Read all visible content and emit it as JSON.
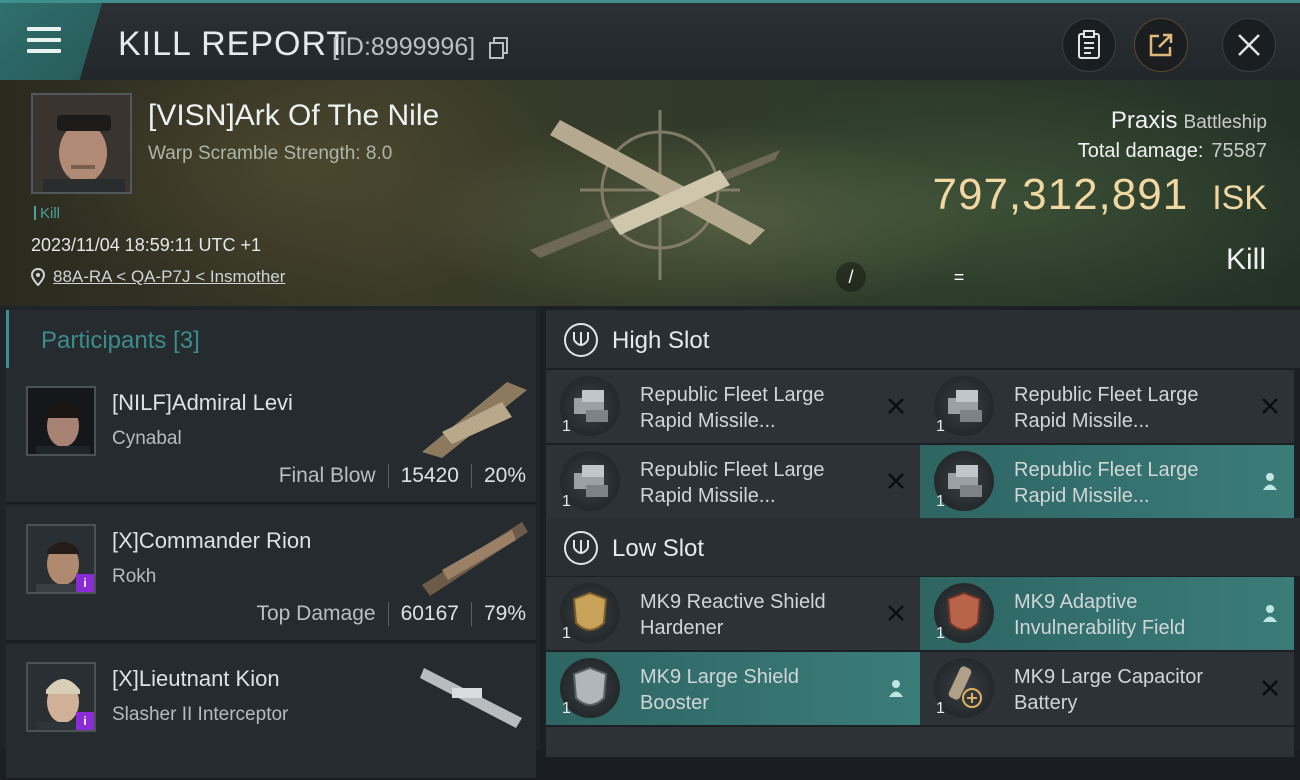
{
  "header": {
    "title": "KILL REPORT",
    "report_id": "[ID:8999996]"
  },
  "victim": {
    "name": "[VISN]Ark Of The Nile",
    "warp_scramble": "Warp Scramble Strength: 8.0",
    "tag": "Kill",
    "timestamp": "2023/11/04 18:59:11 UTC +1",
    "location": "88A-RA < QA-P7J < Insmother",
    "ship": "Praxis",
    "ship_class": "Battleship",
    "total_damage_label": "Total damage:",
    "total_damage": "75587",
    "isk_value": "797,312,891",
    "isk_unit": "ISK",
    "result": "Kill",
    "mark_a": "/",
    "mark_b": "="
  },
  "participants": {
    "title": "Participants [3]",
    "items": [
      {
        "name": "[NILF]Admiral Levi",
        "ship": "Cynabal",
        "role": "Final Blow",
        "damage": "15420",
        "percent": "20%"
      },
      {
        "name": "[X]Commander Rion",
        "ship": "Rokh",
        "role": "Top Damage",
        "damage": "60167",
        "percent": "79%",
        "badge": "i"
      },
      {
        "name": "[X]Lieutnant Kion",
        "ship": "Slasher II Interceptor",
        "badge": "i"
      }
    ]
  },
  "fitting": {
    "high_slot": {
      "title": "High Slot",
      "modules": [
        {
          "name_line1": "Republic Fleet Large",
          "name_line2": "Rapid Missile...",
          "qty": "1",
          "state": "destroyed"
        },
        {
          "name_line1": "Republic Fleet Large",
          "name_line2": "Rapid Missile...",
          "qty": "1",
          "state": "destroyed"
        },
        {
          "name_line1": "Republic Fleet Large",
          "name_line2": "Rapid Missile...",
          "qty": "1",
          "state": "destroyed"
        },
        {
          "name_line1": "Republic Fleet Large",
          "name_line2": "Rapid Missile...",
          "qty": "1",
          "state": "dropped"
        }
      ]
    },
    "low_slot": {
      "title": "Low Slot",
      "modules": [
        {
          "name_line1": "MK9 Reactive Shield",
          "name_line2": "Hardener",
          "qty": "1",
          "state": "destroyed"
        },
        {
          "name_line1": "MK9 Adaptive",
          "name_line2": "Invulnerability Field",
          "qty": "1",
          "state": "dropped"
        },
        {
          "name_line1": "MK9 Large Shield",
          "name_line2": "Booster",
          "qty": "1",
          "state": "dropped"
        },
        {
          "name_line1": "MK9 Large Capacitor",
          "name_line2": "Battery",
          "qty": "1",
          "state": "destroyed"
        }
      ]
    }
  },
  "colors": {
    "accent": "#3f8f8e",
    "isk": "#f1d7a2",
    "highlight_row": "#3a7c79",
    "badge": "#8a2bd8"
  }
}
